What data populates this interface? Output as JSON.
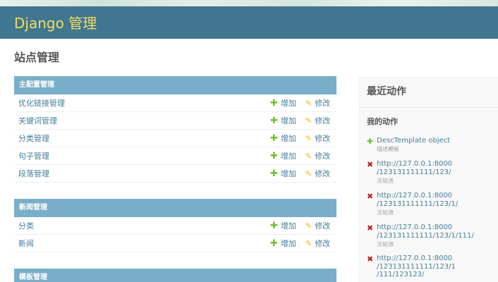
{
  "header": {
    "branding": "Django 管理"
  },
  "page_title": "站点管理",
  "actions": {
    "add_label": "增加",
    "change_label": "修改",
    "add_icon": "plus-icon",
    "change_icon": "pencil-icon"
  },
  "modules": [
    {
      "caption": "主配置管理",
      "models": [
        "优化链接管理",
        "关键词管理",
        "分类管理",
        "句子管理",
        "段落管理"
      ]
    },
    {
      "caption": "新闻管理",
      "models": [
        "分类",
        "新闻"
      ]
    },
    {
      "caption": "模板管理",
      "models": []
    }
  ],
  "recent_actions": {
    "title": "最近动作",
    "subtitle": "我的动作",
    "entries": [
      {
        "kind": "addition",
        "text": "DescTemplate object",
        "type": "描述模板"
      },
      {
        "kind": "deletion",
        "text": "http://127.0.0.1:8000\n/123131111111/123/",
        "type": "泛站池"
      },
      {
        "kind": "deletion",
        "text": "http://127.0.0.1:8000\n/123131111111/123/1/",
        "type": "泛站池"
      },
      {
        "kind": "deletion",
        "text": "http://127.0.0.1:8000\n/123131111111/123/1/111/",
        "type": "泛站池"
      },
      {
        "kind": "deletion",
        "text": "http://127.0.0.1:8000\n/123131111111/123/1\n/111/123123/",
        "type": ""
      }
    ]
  },
  "colors": {
    "header_bg": "#417690",
    "branding": "#f5dd5d",
    "module_caption_bg": "#79aec8",
    "link": "#447e9b",
    "add_green": "#70bf2b",
    "change_yellow": "#efb80b",
    "delete_red": "#ba2121"
  }
}
